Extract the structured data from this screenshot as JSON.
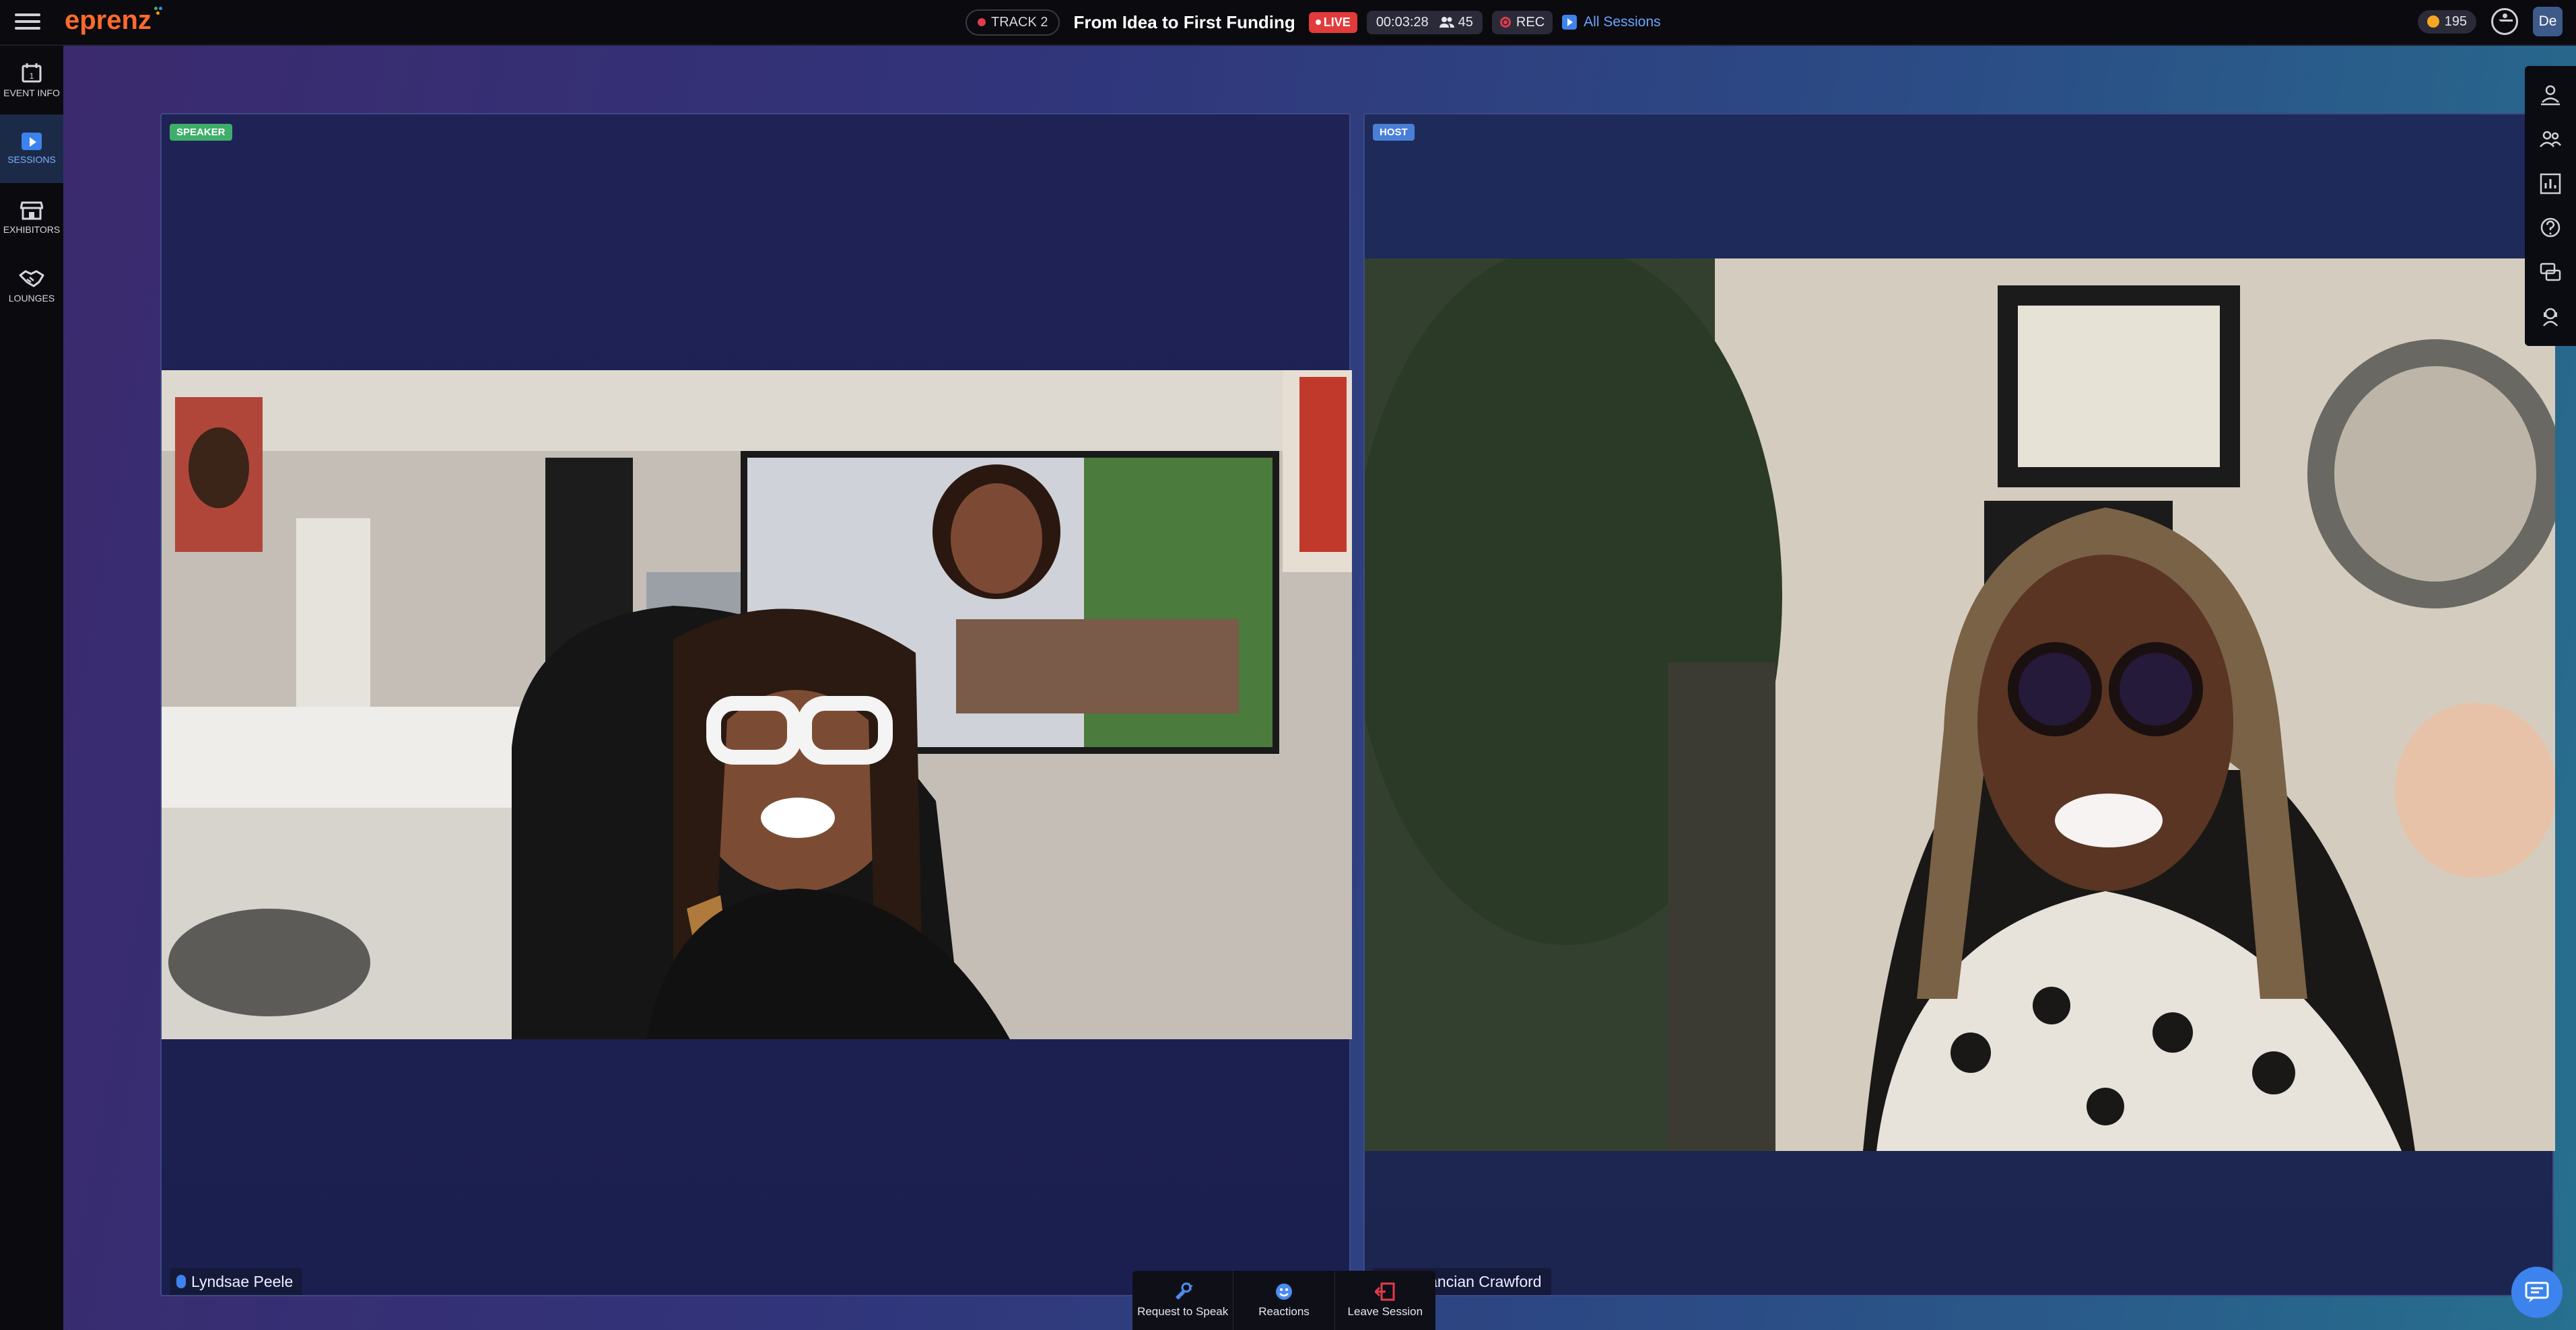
{
  "app": {
    "logo_text": "eprenz"
  },
  "header": {
    "track_label": "TRACK 2",
    "event_title": "From Idea to First Funding",
    "live_label": "LIVE",
    "timer": "00:03:28",
    "attendee_count": "45",
    "rec_label": "REC",
    "all_sessions_label": "All Sessions",
    "coins": "195",
    "avatar_initials": "De"
  },
  "sidebar": {
    "items": [
      {
        "label": "EVENT INFO",
        "icon": "calendar-icon",
        "active": false
      },
      {
        "label": "SESSIONS",
        "icon": "play-icon",
        "active": true
      },
      {
        "label": "EXHIBITORS",
        "icon": "store-icon",
        "active": false
      },
      {
        "label": "LOUNGES",
        "icon": "handshake-icon",
        "active": false
      }
    ]
  },
  "tiles": {
    "left": {
      "role": "SPEAKER",
      "name": "Lyndsae Peele"
    },
    "right": {
      "role": "HOST",
      "name": "Dr. Sancian Crawford"
    }
  },
  "toolbar": {
    "request_label": "Request to Speak",
    "reactions_label": "Reactions",
    "leave_label": "Leave Session"
  },
  "right_rail": {
    "icons": [
      "presenter-icon",
      "people-icon",
      "poll-icon",
      "question-icon",
      "chat-bubbles-icon",
      "support-icon"
    ]
  },
  "colors": {
    "accent": "#3d83ee",
    "live_red": "#e23b3b",
    "speaker_badge": "#3fae6a",
    "host_badge": "#4a7fd6",
    "logo": "#ff6a2b"
  }
}
